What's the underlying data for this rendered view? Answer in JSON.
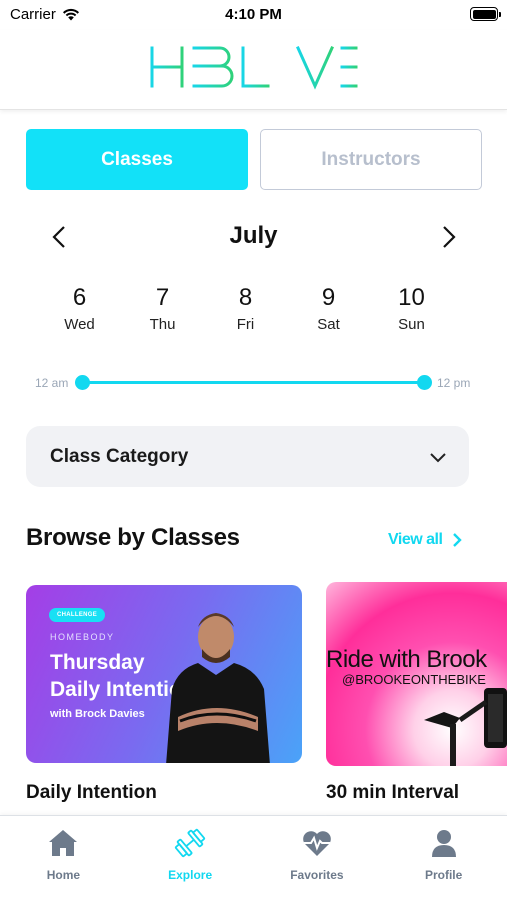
{
  "status_bar": {
    "carrier": "Carrier",
    "time": "4:10 PM"
  },
  "header": {
    "logo_text": "HBLIVE"
  },
  "tabs": {
    "classes": "Classes",
    "instructors": "Instructors",
    "active": "classes"
  },
  "calendar": {
    "month": "July",
    "days": [
      {
        "num": "6",
        "name": "Wed"
      },
      {
        "num": "7",
        "name": "Thu"
      },
      {
        "num": "8",
        "name": "Fri"
      },
      {
        "num": "9",
        "name": "Sat"
      },
      {
        "num": "10",
        "name": "Sun"
      }
    ]
  },
  "time_range": {
    "start_label": "12 am",
    "end_label": "12 pm",
    "start_fraction": 0.0,
    "end_fraction": 1.0
  },
  "category": {
    "placeholder": "Class Category"
  },
  "browse": {
    "title": "Browse by Classes",
    "view_all": "View all",
    "cards": [
      {
        "badge": "CHALLENGE",
        "brand": "HOMEBODY",
        "headline_line1": "Thursday",
        "headline_line2": "Daily Intentions",
        "subtitle": "with Brock Davies",
        "title": "Daily Intention"
      },
      {
        "headline": "Ride with Brook",
        "handle": "@BROOKEONTHEBIKE",
        "title": "30 min Interval"
      }
    ]
  },
  "nav": {
    "items": [
      {
        "label": "Home",
        "icon": "home-icon"
      },
      {
        "label": "Explore",
        "icon": "dumbbell-icon"
      },
      {
        "label": "Favorites",
        "icon": "heart-pulse-icon"
      },
      {
        "label": "Profile",
        "icon": "person-icon"
      }
    ],
    "active": "Explore"
  },
  "colors": {
    "accent": "#12d8f0",
    "text_muted": "#6d7a8b",
    "logo_gradient_start": "#18d6e6",
    "logo_gradient_end": "#2fd27a"
  }
}
